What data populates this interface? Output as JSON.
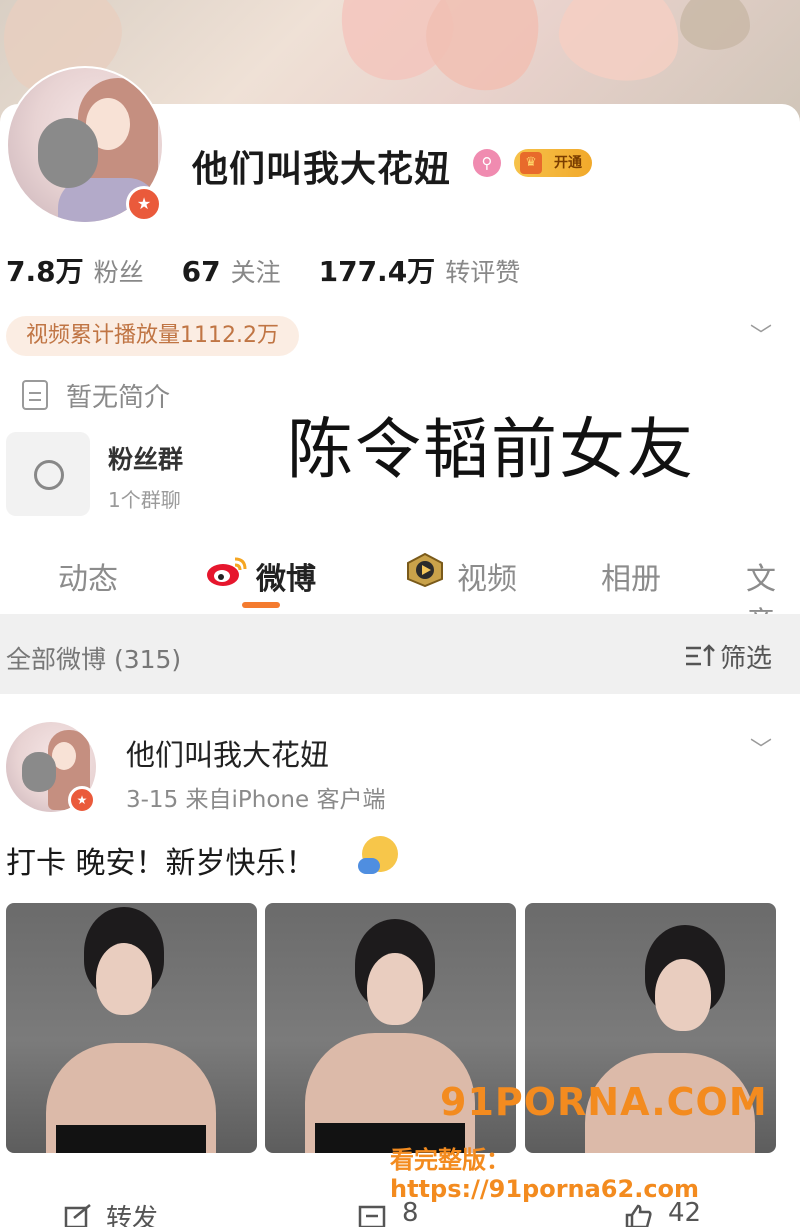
{
  "profile": {
    "username": "他们叫我大花妞",
    "vip_label": "开通",
    "verified_badge": "★",
    "stats": [
      {
        "value": "7.8万",
        "label": "粉丝"
      },
      {
        "value": "67",
        "label": "关注"
      },
      {
        "value": "177.4万",
        "label": "转评赞"
      }
    ],
    "play_count": "视频累计播放量1112.2万",
    "intro": "暂无简介",
    "fan_group": {
      "title": "粉丝群",
      "subtitle": "1个群聊"
    }
  },
  "overlay_caption": "陈令韬前女友",
  "tabs": [
    {
      "label": "动态",
      "active": false
    },
    {
      "label": "微博",
      "active": true
    },
    {
      "label": "视频",
      "active": false
    },
    {
      "label": "相册",
      "active": false
    },
    {
      "label": "文章",
      "active": false
    }
  ],
  "filter": {
    "title": "全部微博 (315)",
    "button": "筛选"
  },
  "post": {
    "author": "他们叫我大花妞",
    "meta": "3-15  来自iPhone 客户端",
    "text": "打卡 晚安！新岁快乐！",
    "actions": {
      "repost": "转发",
      "comments": "8",
      "likes": "42"
    }
  },
  "watermark": {
    "site": "91PORNA.COM",
    "url": "看完整版：https://91porna62.com"
  },
  "colors": {
    "accent": "#f47b2f",
    "vip": "#f1a92b",
    "verify": "#ea5a3b",
    "watermark": "#f38b1f"
  },
  "icons": [
    "chevron-down-icon",
    "document-icon",
    "group-icon",
    "weibo-logo-icon",
    "video-icon",
    "filter-icon",
    "repost-icon",
    "comment-icon",
    "like-icon"
  ]
}
